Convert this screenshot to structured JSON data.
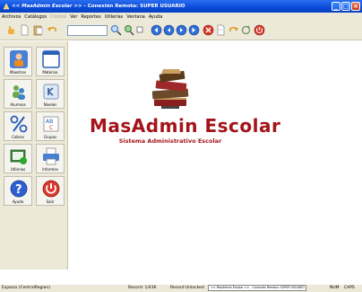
{
  "window": {
    "title_prefix": "<< MasAdmin Escolar >>",
    "title_rest": " - Conexión Remota: SUPER USUARIO",
    "min_label": "_",
    "max_label": "□",
    "close_label": "×"
  },
  "menu": [
    "Archivos",
    "Catálogos",
    "Control",
    "Ver",
    "Reportes",
    "Utilerías",
    "Ventana",
    "Ayuda"
  ],
  "menu_disabled": [
    false,
    false,
    true,
    false,
    false,
    false,
    false,
    false
  ],
  "tiles": [
    {
      "label": "Maestros",
      "icon": "teacher-icon"
    },
    {
      "label": "Materias",
      "icon": "window-icon"
    },
    {
      "label": "Alumnos",
      "icon": "students-icon"
    },
    {
      "label": "Niveles",
      "icon": "levels-icon"
    },
    {
      "label": "Cobros",
      "icon": "percent-icon"
    },
    {
      "label": "Grupos",
      "icon": "groups-icon"
    },
    {
      "label": "Utilerías",
      "icon": "utilities-icon"
    },
    {
      "label": "Informes",
      "icon": "printer-icon"
    },
    {
      "label": "Ayuda",
      "icon": "help-icon"
    },
    {
      "label": "Salir",
      "icon": "power-icon"
    }
  ],
  "logo": {
    "title": "MasAdmin Escolar",
    "subtitle": "Sistema Administrativo Escolar"
  },
  "status": {
    "left": "Espacio (CentralRegion)",
    "record": "Record: 1/436",
    "unlock": "Record Unlocked",
    "box": "<< MasAdmin Escolar >> - Conexión Remota: SUPER USUARIO",
    "num": "NUM",
    "caps": "CAPS"
  },
  "colors": {
    "brand_red": "#a3141a",
    "titlebar_blue": "#0a4ad8",
    "chrome": "#ece9d8"
  }
}
